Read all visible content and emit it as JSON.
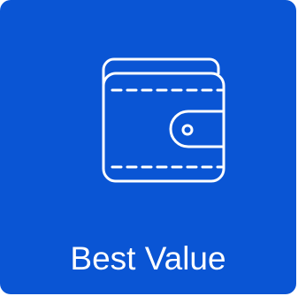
{
  "tile": {
    "label": "Best Value",
    "icon": "wallet-icon",
    "colors": {
      "background": "#0a55d4",
      "foreground": "#ffffff"
    }
  }
}
